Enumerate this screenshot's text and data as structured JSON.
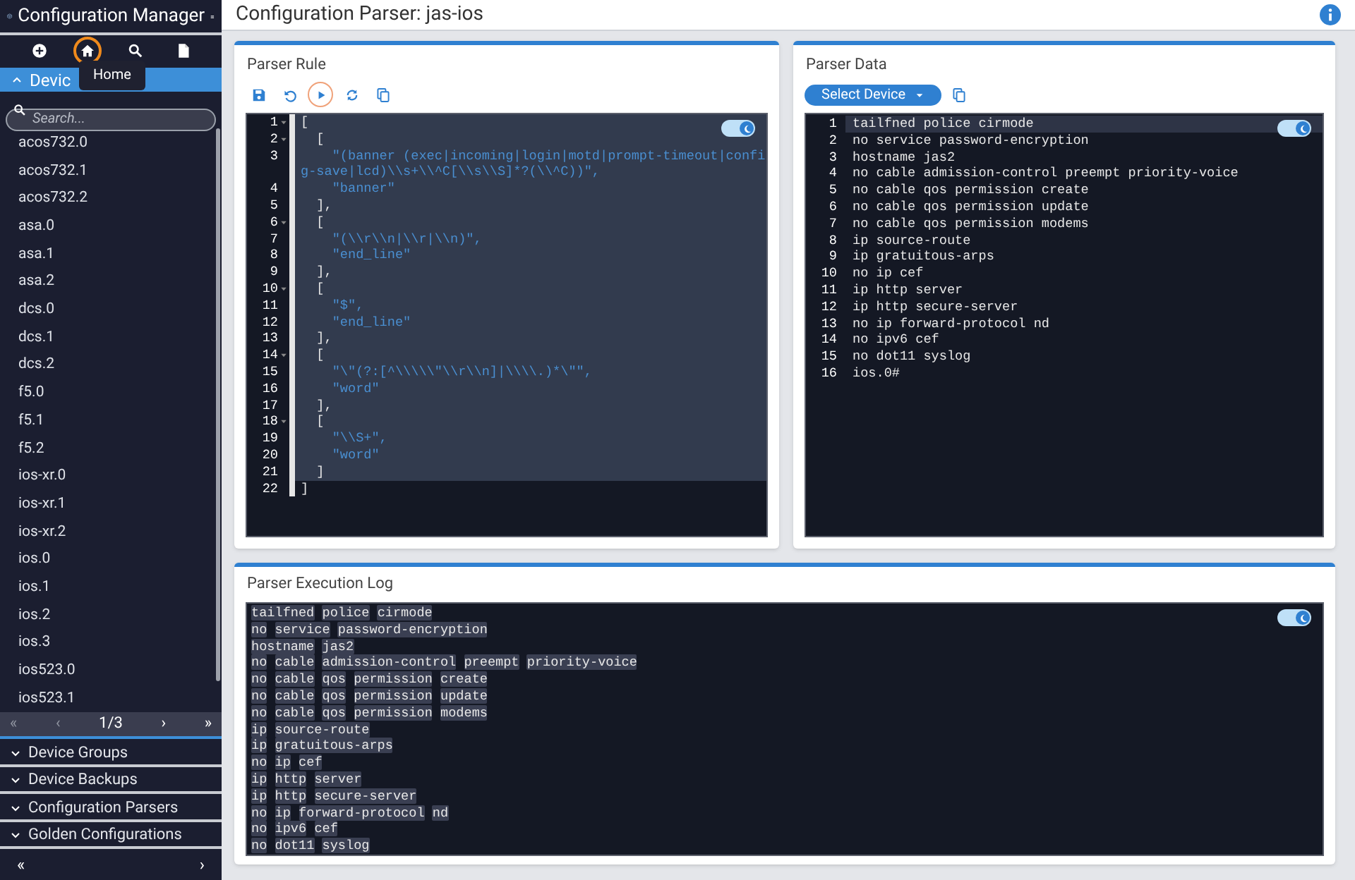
{
  "sidebar": {
    "app_title": "Configuration Manager",
    "icon_buttons": [
      {
        "kind": "add",
        "focused": false
      },
      {
        "kind": "home",
        "focused": true
      },
      {
        "kind": "search",
        "focused": false
      },
      {
        "kind": "file",
        "focused": false
      }
    ],
    "tooltip": "Home",
    "devices_section": {
      "label": "Devic",
      "expanded": true
    },
    "search": {
      "placeholder": "Search..."
    },
    "devices": [
      "acos732.0",
      "acos732.1",
      "acos732.2",
      "asa.0",
      "asa.1",
      "asa.2",
      "dcs.0",
      "dcs.1",
      "dcs.2",
      "f5.0",
      "f5.1",
      "f5.2",
      "ios-xr.0",
      "ios-xr.1",
      "ios-xr.2",
      "ios.0",
      "ios.1",
      "ios.2",
      "ios.3",
      "ios523.0",
      "ios523.1"
    ],
    "pagination": {
      "first": "«",
      "prev": "‹",
      "page": "1/3",
      "next": "›",
      "last": "»"
    },
    "sections": [
      {
        "label": "Device Groups",
        "expanded": false
      },
      {
        "label": "Device Backups",
        "expanded": false
      },
      {
        "label": "Configuration Parsers",
        "expanded": false
      },
      {
        "label": "Golden Configurations",
        "expanded": false
      }
    ],
    "footer": {
      "left": "«",
      "right": "›"
    }
  },
  "page_title": "Configuration Parser: jas-ios",
  "parser_rule": {
    "title": "Parser Rule",
    "toolbar": [
      {
        "kind": "save",
        "focused": false
      },
      {
        "kind": "undo",
        "focused": false
      },
      {
        "kind": "run",
        "focused": true
      },
      {
        "kind": "refresh",
        "focused": false
      },
      {
        "kind": "copy",
        "focused": false
      }
    ],
    "dark_mode": true,
    "lines": [
      {
        "num": "1",
        "text": "[",
        "fold": true,
        "kind": "punct",
        "active": false
      },
      {
        "num": "2",
        "text": "  [",
        "fold": true,
        "kind": "punct",
        "active": false
      },
      {
        "num": "3",
        "text": "    \"(banner (exec|incoming|login|motd|prompt-timeout|config-save|lcd)\\\\s+\\\\^C[\\\\s\\\\S]*?(\\\\^C))\",",
        "fold": false,
        "kind": "string",
        "active": false
      },
      {
        "num": "4",
        "text": "    \"banner\"",
        "fold": false,
        "kind": "string",
        "active": false
      },
      {
        "num": "5",
        "text": "  ],",
        "fold": false,
        "kind": "punct",
        "active": false
      },
      {
        "num": "6",
        "text": "  [",
        "fold": true,
        "kind": "punct",
        "active": false
      },
      {
        "num": "7",
        "text": "    \"(\\\\r\\\\n|\\\\r|\\\\n)\",",
        "fold": false,
        "kind": "string",
        "active": false
      },
      {
        "num": "8",
        "text": "    \"end_line\"",
        "fold": false,
        "kind": "string",
        "active": false
      },
      {
        "num": "9",
        "text": "  ],",
        "fold": false,
        "kind": "punct",
        "active": false
      },
      {
        "num": "10",
        "text": "  [",
        "fold": true,
        "kind": "punct",
        "active": false
      },
      {
        "num": "11",
        "text": "    \"$\",",
        "fold": false,
        "kind": "string",
        "active": false
      },
      {
        "num": "12",
        "text": "    \"end_line\"",
        "fold": false,
        "kind": "string",
        "active": false
      },
      {
        "num": "13",
        "text": "  ],",
        "fold": false,
        "kind": "punct",
        "active": false
      },
      {
        "num": "14",
        "text": "  [",
        "fold": true,
        "kind": "punct",
        "active": false
      },
      {
        "num": "15",
        "text": "    \"\\\"(?:[^\\\\\\\\\\\"\\\\r\\\\n]|\\\\\\\\.)*\\\"\",",
        "fold": false,
        "kind": "string",
        "active": false
      },
      {
        "num": "16",
        "text": "    \"word\"",
        "fold": false,
        "kind": "string",
        "active": false
      },
      {
        "num": "17",
        "text": "  ],",
        "fold": false,
        "kind": "punct",
        "active": false
      },
      {
        "num": "18",
        "text": "  [",
        "fold": true,
        "kind": "punct",
        "active": false
      },
      {
        "num": "19",
        "text": "    \"\\\\S+\",",
        "fold": false,
        "kind": "string",
        "active": false
      },
      {
        "num": "20",
        "text": "    \"word\"",
        "fold": false,
        "kind": "string",
        "active": false
      },
      {
        "num": "21",
        "text": "  ]",
        "fold": false,
        "kind": "punct",
        "active": false
      },
      {
        "num": "22",
        "text": "]",
        "fold": false,
        "kind": "punct",
        "active": true
      }
    ]
  },
  "parser_data": {
    "title": "Parser Data",
    "select_button": "Select Device",
    "dark_mode": true,
    "lines": [
      {
        "num": "1",
        "text": "tailfned police cirmode",
        "active": true
      },
      {
        "num": "2",
        "text": "no service password-encryption",
        "active": false
      },
      {
        "num": "3",
        "text": "hostname jas2",
        "active": false
      },
      {
        "num": "4",
        "text": "no cable admission-control preempt priority-voice",
        "active": false
      },
      {
        "num": "5",
        "text": "no cable qos permission create",
        "active": false
      },
      {
        "num": "6",
        "text": "no cable qos permission update",
        "active": false
      },
      {
        "num": "7",
        "text": "no cable qos permission modems",
        "active": false
      },
      {
        "num": "8",
        "text": "ip source-route",
        "active": false
      },
      {
        "num": "9",
        "text": "ip gratuitous-arps",
        "active": false
      },
      {
        "num": "10",
        "text": "no ip cef",
        "active": false
      },
      {
        "num": "11",
        "text": "ip http server",
        "active": false
      },
      {
        "num": "12",
        "text": "ip http secure-server",
        "active": false
      },
      {
        "num": "13",
        "text": "no ip forward-protocol nd",
        "active": false
      },
      {
        "num": "14",
        "text": "no ipv6 cef",
        "active": false
      },
      {
        "num": "15",
        "text": "no dot11 syslog",
        "active": false
      },
      {
        "num": "16",
        "text": "ios.0#",
        "active": false
      }
    ]
  },
  "execution_log": {
    "title": "Parser Execution Log",
    "dark_mode": true,
    "lines": [
      "tailfned police cirmode",
      "no service password-encryption",
      "hostname jas2",
      "no cable admission-control preempt priority-voice",
      "no cable qos permission create",
      "no cable qos permission update",
      "no cable qos permission modems",
      "ip source-route",
      "ip gratuitous-arps",
      "no ip cef",
      "ip http server",
      "ip http secure-server",
      "no ip forward-protocol nd",
      "no ipv6 cef",
      "no dot11 syslog"
    ]
  }
}
